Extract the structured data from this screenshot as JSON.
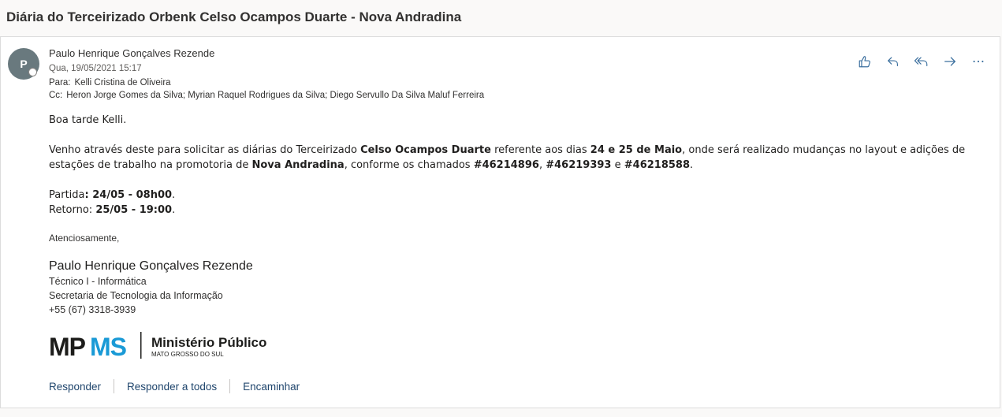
{
  "subject": "Diária do Terceirizado Orbenk Celso Ocampos Duarte - Nova Andradina",
  "message": {
    "avatar_initial": "P",
    "sender": "Paulo Henrique Gonçalves Rezende",
    "date": "Qua, 19/05/2021 15:17",
    "to_label": "Para:",
    "to": "Kelli Cristina de Oliveira",
    "cc_label": "Cc:",
    "cc": "Heron Jorge Gomes da Silva; Myrian Raquel Rodrigues da Silva; Diego Servullo Da Silva Maluf Ferreira"
  },
  "actions": {
    "like_icon": "thumbs-up-icon",
    "reply_icon": "reply-icon",
    "reply_all_icon": "reply-all-icon",
    "forward_icon": "forward-icon",
    "more_icon": "more-icon"
  },
  "body": {
    "greeting": "Boa tarde Kelli.",
    "p1_a": "Venho através deste para solicitar as diárias do Terceirizado ",
    "p1_b": "Celso Ocampos Duarte",
    "p1_c": " referente aos dias ",
    "p1_d": "24 e 25 de Maio",
    "p1_e": ", onde será realizado mudanças no layout e adições de estações de trabalho na promotoria de ",
    "p1_f": "Nova Andradina",
    "p1_g": ", conforme os chamados ",
    "p1_h": "#46214896",
    "p1_i": ", ",
    "p1_j": "#46219393",
    "p1_k": " e ",
    "p1_l": "#46218588",
    "p1_m": ".",
    "departure_label": "Partida",
    "departure_value": ": 24/05 - 08h00",
    "return_label": "Retorno: ",
    "return_value": "25/05 - 19:00",
    "period": "."
  },
  "signature": {
    "closing": "Atenciosamente,",
    "name": "Paulo Henrique Gonçalves Rezende",
    "role": "Técnico I - Informática",
    "department": "Secretaria de Tecnologia da Informação",
    "phone": "+55 (67) 3318-3939",
    "logo_mp": "MP",
    "logo_ms": "MS",
    "logo_org": "Ministério Público",
    "logo_state": "MATO GROSSO DO SUL",
    "logo_mp_color": "#1d1d1b",
    "logo_ms_color": "#1a9ad6"
  },
  "footer": {
    "reply": "Responder",
    "reply_all": "Responder a todos",
    "forward": "Encaminhar"
  }
}
